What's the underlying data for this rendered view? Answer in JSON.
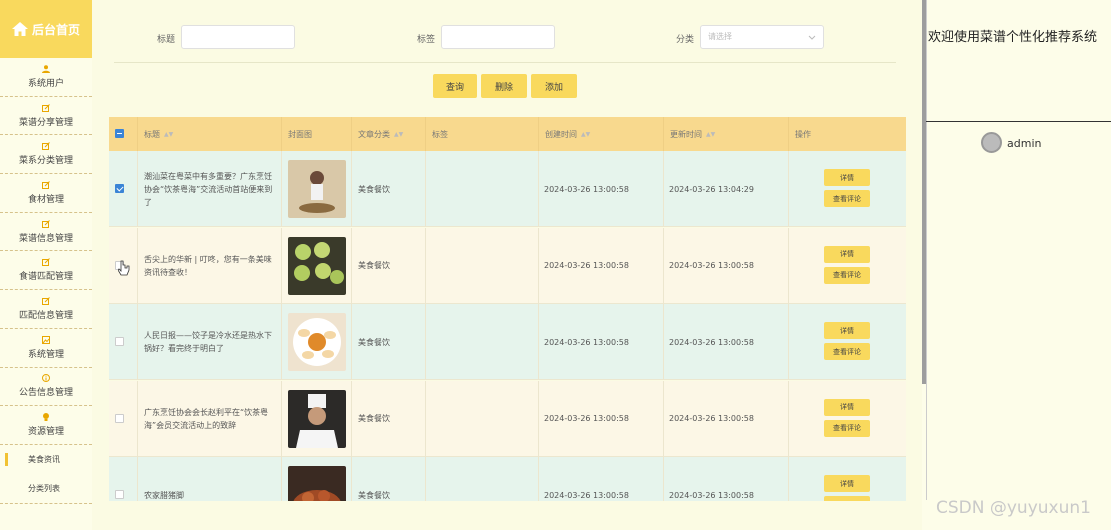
{
  "brand": {
    "title": "后台首页",
    "icon": "home-icon"
  },
  "sidebar": {
    "items": [
      {
        "label": "系统用户",
        "icon": "user-icon"
      },
      {
        "label": "菜谱分享管理",
        "icon": "edit-icon"
      },
      {
        "label": "菜系分类管理",
        "icon": "edit-icon"
      },
      {
        "label": "食材管理",
        "icon": "edit-icon"
      },
      {
        "label": "菜谱信息管理",
        "icon": "edit-icon"
      },
      {
        "label": "食谱匹配管理",
        "icon": "edit-icon"
      },
      {
        "label": "匹配信息管理",
        "icon": "edit-icon"
      },
      {
        "label": "系统管理",
        "icon": "image-icon"
      },
      {
        "label": "公告信息管理",
        "icon": "info-icon"
      },
      {
        "label": "资源管理",
        "icon": "bulb-icon"
      }
    ],
    "subitems": [
      {
        "label": "美食资讯",
        "active": true
      },
      {
        "label": "分类列表",
        "active": false
      }
    ]
  },
  "search": {
    "title_label": "标题",
    "tag_label": "标签",
    "category_label": "分类",
    "category_placeholder": "请选择"
  },
  "actions": {
    "query": "查询",
    "delete": "删除",
    "add": "添加"
  },
  "table": {
    "headers": {
      "title": "标题",
      "cover": "封面图",
      "category": "文章分类",
      "tags": "标签",
      "created": "创建时间",
      "updated": "更新时间",
      "ops": "操作"
    },
    "rows": [
      {
        "title": "潮汕菜在粤菜中有多重要？广东烹饪协会“饮茶粤海”交流活动首站便来到了",
        "category": "美食餐饮",
        "tags": "",
        "created": "2024-03-26 13:00:58",
        "updated": "2024-03-26 13:04:29",
        "checked": true
      },
      {
        "title": "舌尖上的华新 | 叮咚，您有一条美味资讯待查收！",
        "category": "美食餐饮",
        "tags": "",
        "created": "2024-03-26 13:00:58",
        "updated": "2024-03-26 13:00:58",
        "checked": false
      },
      {
        "title": "人民日报——饺子是冷水还是热水下锅好？看完终于明白了",
        "category": "美食餐饮",
        "tags": "",
        "created": "2024-03-26 13:00:58",
        "updated": "2024-03-26 13:00:58",
        "checked": false
      },
      {
        "title": "广东烹饪协会会长赵利平在“饮茶粤海”会员交流活动上的致辞",
        "category": "美食餐饮",
        "tags": "",
        "created": "2024-03-26 13:00:58",
        "updated": "2024-03-26 13:00:58",
        "checked": false
      },
      {
        "title": "农家腊猪脚",
        "category": "美食餐饮",
        "tags": "",
        "created": "2024-03-26 13:00:58",
        "updated": "2024-03-26 13:00:58",
        "checked": false
      }
    ],
    "row_ops": {
      "detail": "详情",
      "comments": "查看评论"
    }
  },
  "right_panel": {
    "welcome": "欢迎使用菜谱个性化推荐系统",
    "username": "admin"
  },
  "watermark": "CSDN @yuyuxun1",
  "colors": {
    "accent": "#f9d95d",
    "header": "#f8d98e",
    "row_a": "#e6f4ec",
    "row_b": "#fcf7e6",
    "checkbox": "#3b84d6"
  }
}
